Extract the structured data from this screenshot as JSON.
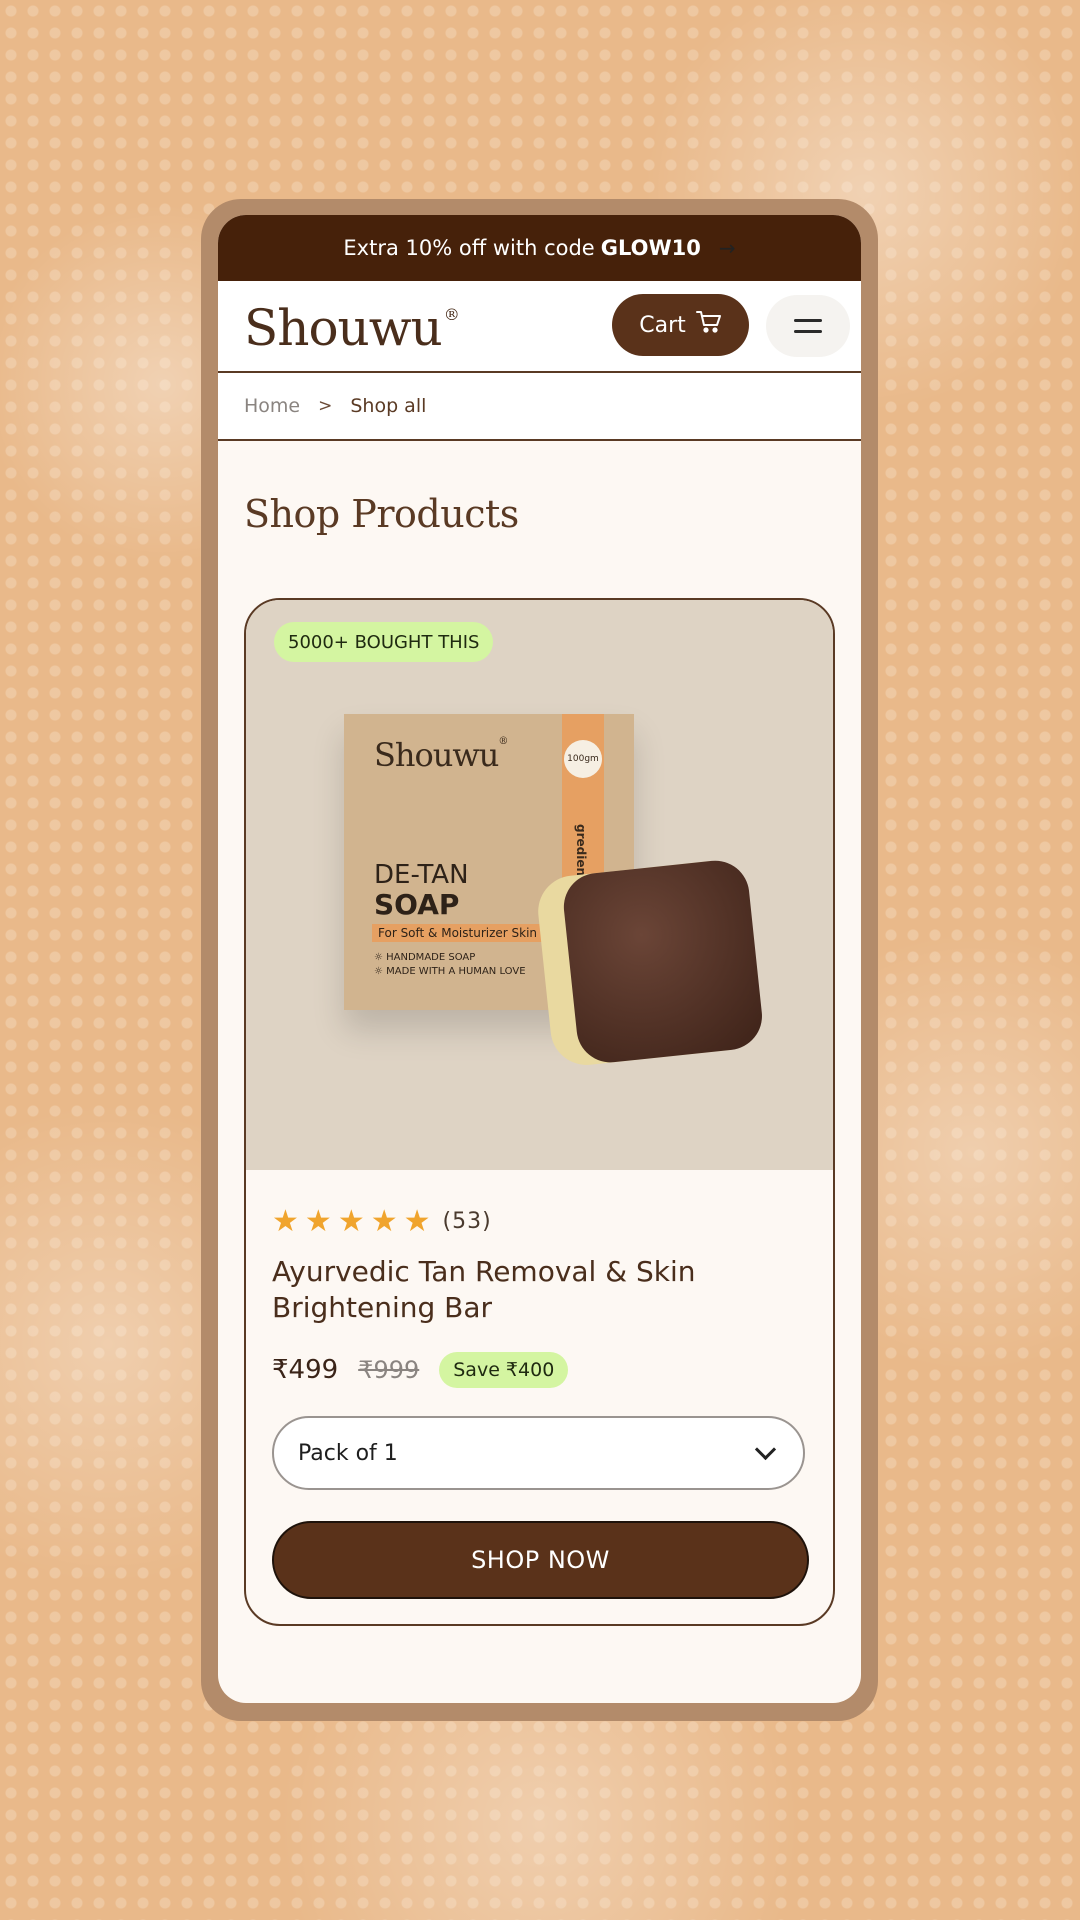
{
  "announcement": {
    "text": "Extra 10% off with code ",
    "code": "GLOW10",
    "arrow": "→"
  },
  "header": {
    "logo": "Shouwu",
    "logo_mark": "®",
    "cart_label": "Cart",
    "cart_icon": "shopping-cart-icon",
    "menu_icon": "hamburger-menu-icon"
  },
  "breadcrumb": {
    "home": "Home",
    "separator": ">",
    "current": "Shop all"
  },
  "page": {
    "title": "Shop Products"
  },
  "product": {
    "badge": "5000+ BOUGHT THIS",
    "packaging": {
      "brand": "Shouwu",
      "brand_mark": "®",
      "weight": "100gm",
      "stripe_text": "gredients e Product",
      "line1": "DE-TAN",
      "line2": "SOAP",
      "tagline": "For Soft & Moisturizer Skin",
      "feature1": "☼ HANDMADE SOAP",
      "feature2": "☼ MADE WITH A HUMAN LOVE"
    },
    "stars": 5,
    "review_count": "(53)",
    "name": "Ayurvedic Tan Removal & Skin Brightening Bar",
    "price": "₹499",
    "mrp": "₹999",
    "save": "Save ₹400",
    "variant": "Pack of 1",
    "cta": "SHOP NOW"
  },
  "colors": {
    "announcement_bg": "#46210a",
    "brand_brown": "#5a321a",
    "accent_green": "#d4f5a1",
    "star": "#f0a42d"
  }
}
